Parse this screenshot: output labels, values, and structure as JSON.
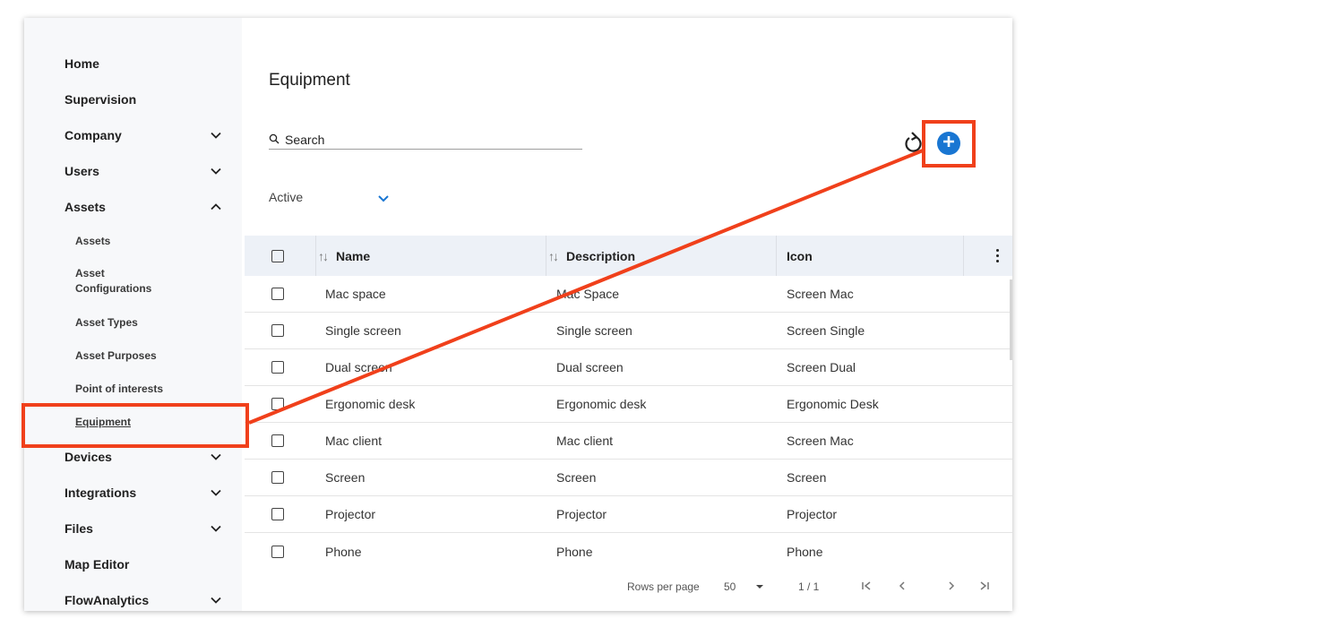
{
  "sidebar": {
    "items": [
      {
        "label": "Home",
        "chevron": ""
      },
      {
        "label": "Supervision",
        "chevron": ""
      },
      {
        "label": "Company",
        "chevron": "chevron-down"
      },
      {
        "label": "Users",
        "chevron": "chevron-down"
      },
      {
        "label": "Assets",
        "chevron": "chevron-up"
      }
    ],
    "sub_items": [
      {
        "label": "Assets"
      },
      {
        "label": "Asset Configurations"
      },
      {
        "label": "Asset Types"
      },
      {
        "label": "Asset Purposes"
      },
      {
        "label": "Point of interests"
      },
      {
        "label": "Equipment",
        "active": true
      }
    ],
    "items_after": [
      {
        "label": "Devices",
        "chevron": "chevron-down"
      },
      {
        "label": "Integrations",
        "chevron": "chevron-down"
      },
      {
        "label": "Files",
        "chevron": "chevron-down"
      },
      {
        "label": "Map Editor",
        "chevron": ""
      },
      {
        "label": "FlowAnalytics",
        "chevron": "chevron-down"
      }
    ]
  },
  "main": {
    "title": "Equipment",
    "search": {
      "placeholder": "Search",
      "value": ""
    },
    "filter": {
      "selected": "Active"
    },
    "table": {
      "columns": [
        "Name",
        "Description",
        "Icon"
      ],
      "rows": [
        [
          "Mac space",
          "Mac Space",
          "Screen Mac"
        ],
        [
          "Single screen",
          "Single screen",
          "Screen Single"
        ],
        [
          "Dual screen",
          "Dual screen",
          "Screen Dual"
        ],
        [
          "Ergonomic desk",
          "Ergonomic desk",
          "Ergonomic Desk"
        ],
        [
          "Mac client",
          "Mac client",
          "Screen Mac"
        ],
        [
          "Screen",
          "Screen",
          "Screen"
        ],
        [
          "Projector",
          "Projector",
          "Projector"
        ],
        [
          "Phone",
          "Phone",
          "Phone"
        ]
      ]
    },
    "pagination": {
      "rows_per_page_label": "Rows per page",
      "rows_per_page_value": "50",
      "page_info": "1 / 1"
    }
  },
  "colors": {
    "accent": "#1976d2",
    "highlight": "#f0401b",
    "sidebar_bg": "#f7f8fa",
    "header_bg": "#edf1f7"
  },
  "icons": [
    "search-icon",
    "refresh-icon",
    "add-icon",
    "chevron-down-icon",
    "chevron-up-icon",
    "sort-icon",
    "more-vert-icon",
    "first-page-icon",
    "prev-page-icon",
    "next-page-icon",
    "last-page-icon"
  ]
}
